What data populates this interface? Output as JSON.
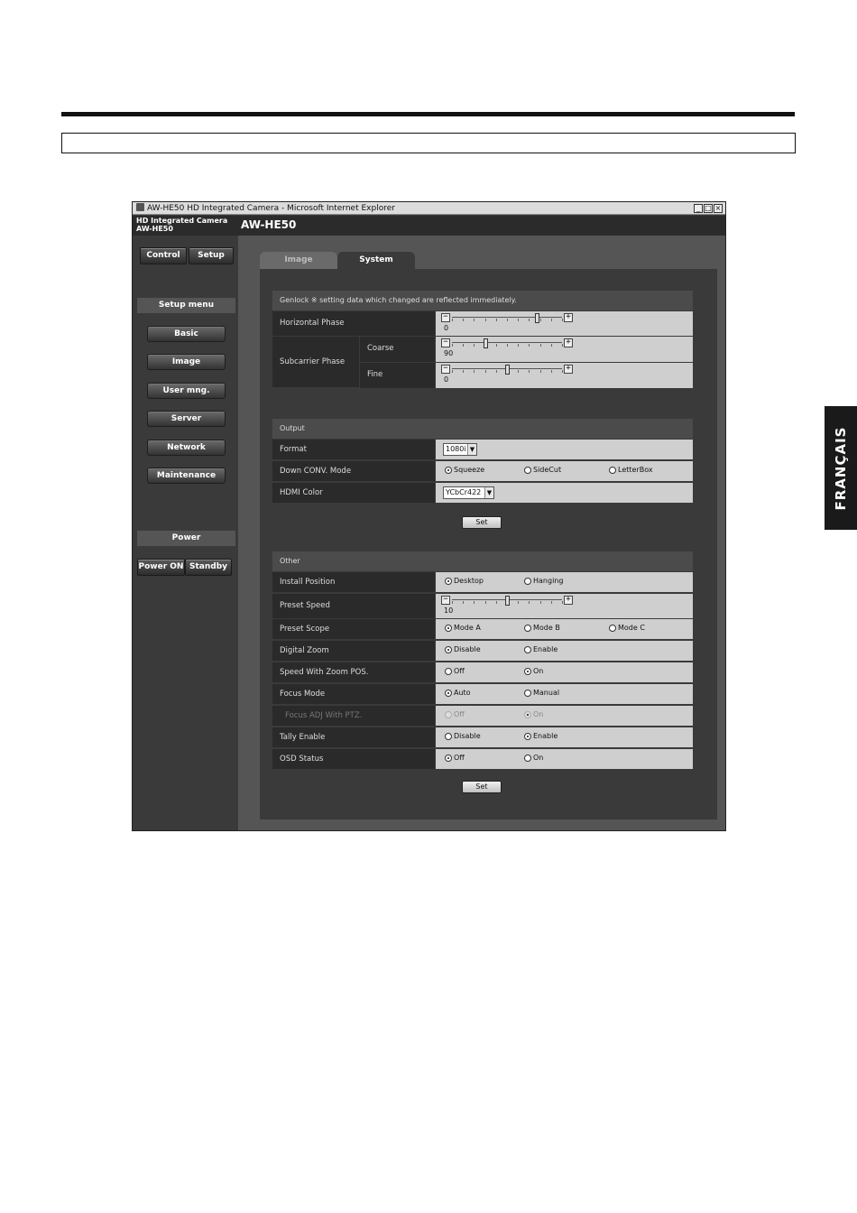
{
  "side_tab": {
    "label": "FRANÇAIS"
  },
  "window": {
    "title": "AW-HE50 HD Integrated Camera - Microsoft Internet Explorer",
    "controls": [
      "_",
      "□",
      "×"
    ]
  },
  "header": {
    "brand_line1": "HD Integrated Camera",
    "brand_line2": "AW-HE50",
    "model": "AW-HE50"
  },
  "sidebar": {
    "control_label": "Control",
    "setup_label": "Setup",
    "setup_menu_title": "Setup menu",
    "menu": [
      "Basic",
      "Image",
      "User mng.",
      "Server",
      "Network",
      "Maintenance"
    ],
    "power_title": "Power",
    "power_on_label": "Power ON",
    "standby_label": "Standby"
  },
  "tabs": {
    "image": "Image",
    "system": "System"
  },
  "genlock": {
    "title": "Genlock  ※ setting data which changed are reflected immediately.",
    "horizontal_phase": {
      "label": "Horizontal Phase",
      "value": "0",
      "position": 0.77
    },
    "subcarrier_phase": {
      "label": "Subcarrier Phase",
      "coarse": {
        "label": "Coarse",
        "value": "90",
        "position": 0.3
      },
      "fine": {
        "label": "Fine",
        "value": "0",
        "position": 0.5
      }
    }
  },
  "output": {
    "title": "Output",
    "format": {
      "label": "Format",
      "value": "1080i"
    },
    "down_conv": {
      "label": "Down CONV. Mode",
      "options": [
        "Squeeze",
        "SideCut",
        "LetterBox"
      ],
      "selected": 0
    },
    "hdmi_color": {
      "label": "HDMI Color",
      "value": "YCbCr422"
    },
    "set_label": "Set"
  },
  "other": {
    "title": "Other",
    "install_position": {
      "label": "Install Position",
      "options": [
        "Desktop",
        "Hanging"
      ],
      "selected": 0
    },
    "preset_speed": {
      "label": "Preset Speed",
      "value": "10",
      "position": 0.5
    },
    "preset_scope": {
      "label": "Preset Scope",
      "options": [
        "Mode A",
        "Mode B",
        "Mode C"
      ],
      "selected": 0
    },
    "digital_zoom": {
      "label": "Digital Zoom",
      "options": [
        "Disable",
        "Enable"
      ],
      "selected": 0
    },
    "speed_zoom": {
      "label": "Speed With Zoom POS.",
      "options": [
        "Off",
        "On"
      ],
      "selected": 1
    },
    "focus_mode": {
      "label": "Focus Mode",
      "options": [
        "Auto",
        "Manual"
      ],
      "selected": 0
    },
    "focus_adj": {
      "label": "Focus ADJ With PTZ.",
      "options": [
        "Off",
        "On"
      ],
      "selected": 1
    },
    "tally": {
      "label": "Tally Enable",
      "options": [
        "Disable",
        "Enable"
      ],
      "selected": 1
    },
    "osd": {
      "label": "OSD Status",
      "options": [
        "Off",
        "On"
      ],
      "selected": 0
    },
    "set_label": "Set"
  }
}
